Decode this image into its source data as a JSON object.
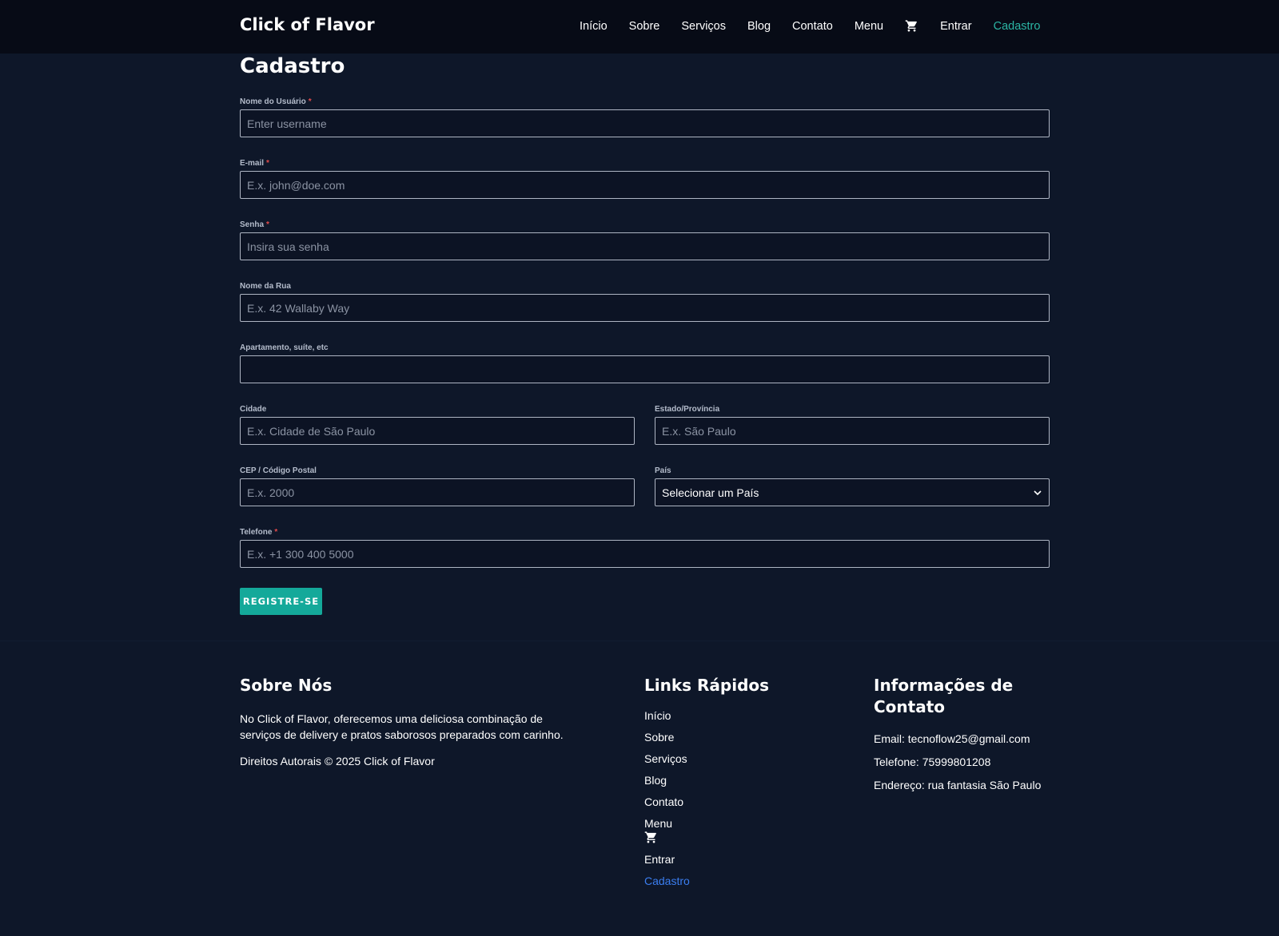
{
  "header": {
    "brand": "Click of Flavor",
    "nav": [
      "Início",
      "Sobre",
      "Serviços",
      "Blog",
      "Contato",
      "Menu"
    ],
    "cart_icon": "cart-icon",
    "login": "Entrar",
    "signup": "Cadastro",
    "accent_color": "#2bb5a4"
  },
  "form": {
    "title": "Cadastro",
    "username": {
      "label": "Nome do Usuário",
      "required": "*",
      "placeholder": "Enter username",
      "value": ""
    },
    "email": {
      "label": "E-mail",
      "required": "*",
      "placeholder": "E.x. john@doe.com",
      "value": ""
    },
    "password": {
      "label": "Senha",
      "required": "*",
      "placeholder": "Insira sua senha",
      "value": ""
    },
    "street": {
      "label": "Nome da Rua",
      "placeholder": "E.x. 42 Wallaby Way",
      "value": ""
    },
    "apartment": {
      "label": "Apartamento, suíte, etc",
      "placeholder": "",
      "value": ""
    },
    "city": {
      "label": "Cidade",
      "placeholder": "E.x. Cidade de São Paulo",
      "value": ""
    },
    "state": {
      "label": "Estado/Província",
      "placeholder": "E.x. São Paulo",
      "value": ""
    },
    "zip": {
      "label": "CEP / Código Postal",
      "placeholder": "E.x. 2000",
      "value": ""
    },
    "country": {
      "label": "País",
      "selected": "Selecionar um País"
    },
    "phone": {
      "label": "Telefone",
      "required": "*",
      "placeholder": "E.x. +1 300 400 5000",
      "value": ""
    },
    "submit": "REGISTRE-SE",
    "button_color": "#14a99a"
  },
  "footer": {
    "about": {
      "title": "Sobre Nós",
      "text_line1": "No Click of Flavor, oferecemos uma deliciosa combinação de",
      "text_line2": "serviços de delivery e pratos saborosos preparados com carinho.",
      "copyright": "Direitos Autorais © 2025 Click of Flavor"
    },
    "links": {
      "title": "Links Rápidos",
      "items": [
        "Início",
        "Sobre",
        "Serviços",
        "Blog",
        "Contato",
        "Menu"
      ],
      "login": "Entrar",
      "signup": "Cadastro",
      "active_color": "#3b7ef0"
    },
    "contact": {
      "title_line1": "Informações de",
      "title_line2": "Contato",
      "email": "Email: tecnoflow25@gmail.com",
      "phone": "Telefone: 75999801208",
      "address": "Endereço: rua fantasia São Paulo"
    }
  }
}
